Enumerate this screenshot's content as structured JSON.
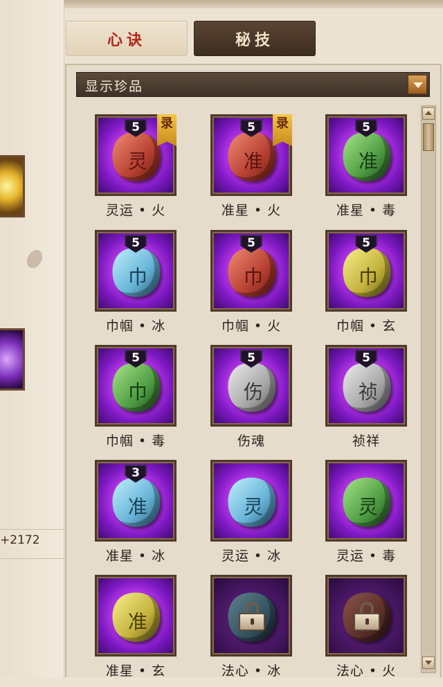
{
  "tabs": [
    {
      "label": "心诀",
      "active": false
    },
    {
      "label": "秘技",
      "active": true
    }
  ],
  "filter": {
    "label": "显示珍品"
  },
  "side": {
    "partial_number": "2172"
  },
  "colors": {
    "accent_tab_text": "#b0251c",
    "slot_purple": "#c43ef0",
    "bar_brown": "#4e3e32"
  },
  "items": [
    {
      "label": "灵运 • 火",
      "level": "5",
      "tag": "录",
      "rune": "灵",
      "color": "red",
      "locked": false
    },
    {
      "label": "准星 • 火",
      "level": "5",
      "tag": "录",
      "rune": "准",
      "color": "red",
      "locked": false
    },
    {
      "label": "准星 • 毒",
      "level": "5",
      "tag": "",
      "rune": "准",
      "color": "green",
      "locked": false
    },
    {
      "label": "巾帼 • 冰",
      "level": "5",
      "tag": "",
      "rune": "巾",
      "color": "blue",
      "locked": false
    },
    {
      "label": "巾帼 • 火",
      "level": "5",
      "tag": "",
      "rune": "巾",
      "color": "red",
      "locked": false
    },
    {
      "label": "巾帼 • 玄",
      "level": "5",
      "tag": "",
      "rune": "巾",
      "color": "yellow",
      "locked": false
    },
    {
      "label": "巾帼 • 毒",
      "level": "5",
      "tag": "",
      "rune": "巾",
      "color": "green",
      "locked": false
    },
    {
      "label": "伤魂",
      "level": "5",
      "tag": "",
      "rune": "伤",
      "color": "grey",
      "locked": false
    },
    {
      "label": "祯祥",
      "level": "5",
      "tag": "",
      "rune": "祯",
      "color": "grey",
      "locked": false
    },
    {
      "label": "准星 • 冰",
      "level": "3",
      "tag": "",
      "rune": "准",
      "color": "blue",
      "locked": false
    },
    {
      "label": "灵运 • 冰",
      "level": "",
      "tag": "",
      "rune": "灵",
      "color": "blue",
      "locked": false
    },
    {
      "label": "灵运 • 毒",
      "level": "",
      "tag": "",
      "rune": "灵",
      "color": "green",
      "locked": false
    },
    {
      "label": "准星 • 玄",
      "level": "",
      "tag": "",
      "rune": "准",
      "color": "yellow",
      "locked": false
    },
    {
      "label": "法心 • 冰",
      "level": "",
      "tag": "",
      "rune": "",
      "color": "dimblue",
      "locked": true
    },
    {
      "label": "法心 • 火",
      "level": "",
      "tag": "",
      "rune": "",
      "color": "dimred",
      "locked": true
    }
  ]
}
